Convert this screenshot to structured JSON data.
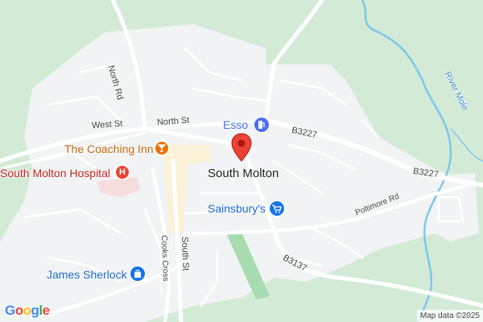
{
  "map": {
    "town_label": "South Molton",
    "roads": {
      "north_rd": "North Rd",
      "west_st": "West St",
      "north_st": "North St",
      "b3227_a": "B3227",
      "b3227_b": "B3227",
      "poltimore_rd": "Poltimore Rd",
      "b3137": "B3137",
      "cooks_cross": "Cooks Cross",
      "south_st": "South St"
    },
    "water": {
      "river_mole": "River Mole"
    },
    "pois": [
      {
        "label": "The Coaching Inn",
        "icon": "cocktail-icon",
        "color": "#e8710a"
      },
      {
        "label": "South Molton Hospital",
        "icon": "hospital-icon",
        "color": "#e94235"
      },
      {
        "label": "Esso",
        "icon": "fuel-icon",
        "color": "#4b6ef5"
      },
      {
        "label": "Sainsbury's",
        "icon": "shopping-cart-icon",
        "color": "#1a73e8"
      },
      {
        "label": "James Sherlock",
        "icon": "shopping-bag-icon",
        "color": "#1a73e8"
      }
    ],
    "marker": {
      "icon": "map-pin-icon",
      "color": "#ea4335"
    },
    "branding": {
      "logo": "Google",
      "attribution": "Map data ©2025"
    },
    "colors": {
      "land": "#d3ebd6",
      "urban": "#f1f3f4",
      "road": "#ffffff",
      "water": "#7fc6e9",
      "park": "#a8dcb0"
    }
  }
}
